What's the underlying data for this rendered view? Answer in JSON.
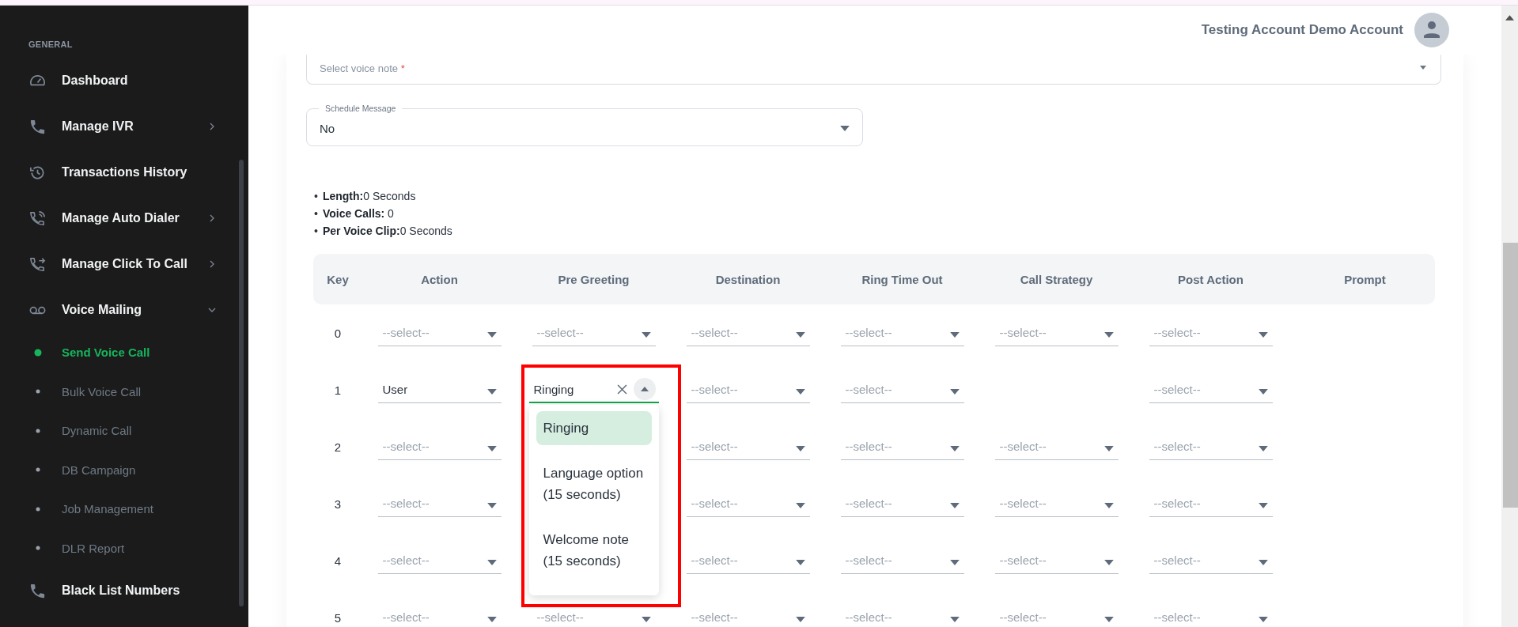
{
  "header": {
    "user_name": "Testing Account Demo Account"
  },
  "sidebar": {
    "section": "GENERAL",
    "items": [
      {
        "label": "Dashboard"
      },
      {
        "label": "Manage IVR",
        "expanded": false
      },
      {
        "label": "Transactions History"
      },
      {
        "label": "Manage Auto Dialer",
        "expanded": false
      },
      {
        "label": "Manage Click To Call",
        "expanded": false
      },
      {
        "label": "Voice Mailing",
        "expanded": true,
        "children": [
          {
            "label": "Send Voice Call",
            "selected": true
          },
          {
            "label": "Bulk Voice Call",
            "selected": false
          },
          {
            "label": "Dynamic Call",
            "selected": false
          },
          {
            "label": "DB Campaign",
            "selected": false
          },
          {
            "label": "Job Management",
            "selected": false
          },
          {
            "label": "DLR Report",
            "selected": false
          }
        ]
      },
      {
        "label": "Black List Numbers"
      }
    ]
  },
  "form": {
    "voice_note": {
      "placeholder": "Select voice note",
      "required_mark": "*"
    },
    "schedule": {
      "label": "Schedule Message",
      "value": "No"
    }
  },
  "summary": [
    {
      "marker": "•",
      "text": "**Length:**0 Seconds"
    },
    {
      "marker": "•",
      "text": "**Voice Calls:** 0"
    },
    {
      "marker": "•",
      "text": "**Per Voice Clip:**0 Seconds"
    }
  ],
  "table": {
    "columns": [
      "Key",
      "Action",
      "Pre Greeting",
      "Destination",
      "Ring Time Out",
      "Call Strategy",
      "Post Action",
      "Prompt"
    ],
    "rows": [
      {
        "cells": [
          {
            "kind": "text",
            "value": "0"
          },
          {
            "kind": "select",
            "placeholder": "--select--"
          },
          {
            "kind": "select",
            "placeholder": "--select--"
          },
          {
            "kind": "select",
            "placeholder": "--select--"
          },
          {
            "kind": "select",
            "placeholder": "--select--"
          },
          {
            "kind": "select",
            "placeholder": "--select--"
          },
          {
            "kind": "select",
            "placeholder": "--select--"
          },
          {
            "kind": "empty"
          }
        ]
      },
      {
        "cells": [
          {
            "kind": "text",
            "value": "1"
          },
          {
            "kind": "select",
            "value": "User"
          },
          {
            "kind": "autocomplete",
            "value": "Ringing",
            "open": true,
            "highlighted": true,
            "options": [
              {
                "label": "Ringing",
                "selected": true
              },
              {
                "label": "Language option (15 seconds)",
                "selected": false
              },
              {
                "label": "Welcome note (15 seconds)",
                "selected": false
              }
            ]
          },
          {
            "kind": "select",
            "placeholder": "--select--"
          },
          {
            "kind": "select",
            "placeholder": "--select--"
          },
          {
            "kind": "empty"
          },
          {
            "kind": "select",
            "placeholder": "--select--"
          },
          {
            "kind": "empty"
          }
        ]
      },
      {
        "cells": [
          {
            "kind": "text",
            "value": "2"
          },
          {
            "kind": "select",
            "placeholder": "--select--"
          },
          {
            "kind": "empty"
          },
          {
            "kind": "select",
            "placeholder": "--select--"
          },
          {
            "kind": "select",
            "placeholder": "--select--"
          },
          {
            "kind": "select",
            "placeholder": "--select--"
          },
          {
            "kind": "select",
            "placeholder": "--select--"
          },
          {
            "kind": "empty"
          }
        ]
      },
      {
        "cells": [
          {
            "kind": "text",
            "value": "3"
          },
          {
            "kind": "select",
            "placeholder": "--select--"
          },
          {
            "kind": "empty"
          },
          {
            "kind": "select",
            "placeholder": "--select--"
          },
          {
            "kind": "select",
            "placeholder": "--select--"
          },
          {
            "kind": "select",
            "placeholder": "--select--"
          },
          {
            "kind": "select",
            "placeholder": "--select--"
          },
          {
            "kind": "empty"
          }
        ]
      },
      {
        "cells": [
          {
            "kind": "text",
            "value": "4"
          },
          {
            "kind": "select",
            "placeholder": "--select--"
          },
          {
            "kind": "empty"
          },
          {
            "kind": "select",
            "placeholder": "--select--"
          },
          {
            "kind": "select",
            "placeholder": "--select--"
          },
          {
            "kind": "select",
            "placeholder": "--select--"
          },
          {
            "kind": "select",
            "placeholder": "--select--"
          },
          {
            "kind": "empty"
          }
        ]
      },
      {
        "cells": [
          {
            "kind": "text",
            "value": "5"
          },
          {
            "kind": "select",
            "placeholder": "--select--"
          },
          {
            "kind": "select",
            "placeholder": "--select--"
          },
          {
            "kind": "select",
            "placeholder": "--select--"
          },
          {
            "kind": "select",
            "placeholder": "--select--"
          },
          {
            "kind": "select",
            "placeholder": "--select--"
          },
          {
            "kind": "select",
            "placeholder": "--select--"
          },
          {
            "kind": "empty"
          }
        ]
      }
    ]
  }
}
